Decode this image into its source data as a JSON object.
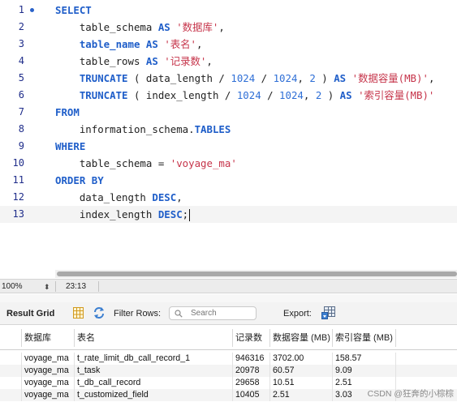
{
  "editor": {
    "lines": [
      {
        "no": "1",
        "tokens": [
          {
            "t": "SELECT",
            "c": "kw"
          }
        ]
      },
      {
        "no": "2",
        "tokens": [
          {
            "t": "    table_schema ",
            "c": "ob"
          },
          {
            "t": "AS",
            "c": "kw"
          },
          {
            "t": " ",
            "c": "ob"
          },
          {
            "t": "'数据库'",
            "c": "str"
          },
          {
            "t": ",",
            "c": "ob"
          }
        ]
      },
      {
        "no": "3",
        "tokens": [
          {
            "t": "    ",
            "c": "ob"
          },
          {
            "t": "table_name",
            "c": "id"
          },
          {
            "t": " ",
            "c": "ob"
          },
          {
            "t": "AS",
            "c": "kw"
          },
          {
            "t": " ",
            "c": "ob"
          },
          {
            "t": "'表名'",
            "c": "str"
          },
          {
            "t": ",",
            "c": "ob"
          }
        ]
      },
      {
        "no": "4",
        "tokens": [
          {
            "t": "    table_rows ",
            "c": "ob"
          },
          {
            "t": "AS",
            "c": "kw"
          },
          {
            "t": " ",
            "c": "ob"
          },
          {
            "t": "'记录数'",
            "c": "str"
          },
          {
            "t": ",",
            "c": "ob"
          }
        ]
      },
      {
        "no": "5",
        "tokens": [
          {
            "t": "    ",
            "c": "ob"
          },
          {
            "t": "TRUNCATE",
            "c": "fn"
          },
          {
            "t": " ( data_length / ",
            "c": "ob"
          },
          {
            "t": "1024",
            "c": "num"
          },
          {
            "t": " / ",
            "c": "ob"
          },
          {
            "t": "1024",
            "c": "num"
          },
          {
            "t": ", ",
            "c": "ob"
          },
          {
            "t": "2",
            "c": "num"
          },
          {
            "t": " ) ",
            "c": "ob"
          },
          {
            "t": "AS",
            "c": "kw"
          },
          {
            "t": " ",
            "c": "ob"
          },
          {
            "t": "'数据容量(MB)'",
            "c": "str"
          },
          {
            "t": ",",
            "c": "ob"
          }
        ]
      },
      {
        "no": "6",
        "tokens": [
          {
            "t": "    ",
            "c": "ob"
          },
          {
            "t": "TRUNCATE",
            "c": "fn"
          },
          {
            "t": " ( index_length / ",
            "c": "ob"
          },
          {
            "t": "1024",
            "c": "num"
          },
          {
            "t": " / ",
            "c": "ob"
          },
          {
            "t": "1024",
            "c": "num"
          },
          {
            "t": ", ",
            "c": "ob"
          },
          {
            "t": "2",
            "c": "num"
          },
          {
            "t": " ) ",
            "c": "ob"
          },
          {
            "t": "AS",
            "c": "kw"
          },
          {
            "t": " ",
            "c": "ob"
          },
          {
            "t": "'索引容量(MB)'",
            "c": "str"
          }
        ]
      },
      {
        "no": "7",
        "tokens": [
          {
            "t": "FROM",
            "c": "kw"
          }
        ]
      },
      {
        "no": "8",
        "tokens": [
          {
            "t": "    information_schema.",
            "c": "ob"
          },
          {
            "t": "TABLES",
            "c": "id"
          }
        ]
      },
      {
        "no": "9",
        "tokens": [
          {
            "t": "WHERE",
            "c": "kw"
          }
        ]
      },
      {
        "no": "10",
        "tokens": [
          {
            "t": "    table_schema = ",
            "c": "ob"
          },
          {
            "t": "'voyage_ma'",
            "c": "str"
          }
        ]
      },
      {
        "no": "11",
        "tokens": [
          {
            "t": "ORDER BY",
            "c": "kw"
          }
        ]
      },
      {
        "no": "12",
        "tokens": [
          {
            "t": "    data_length ",
            "c": "ob"
          },
          {
            "t": "DESC",
            "c": "kw"
          },
          {
            "t": ",",
            "c": "ob"
          }
        ]
      },
      {
        "no": "13",
        "tokens": [
          {
            "t": "    index_length ",
            "c": "ob"
          },
          {
            "t": "DESC",
            "c": "kw"
          },
          {
            "t": ";",
            "c": "ob"
          }
        ]
      }
    ]
  },
  "statusbar": {
    "zoom": "100%",
    "cursor": "23:13"
  },
  "toolbar": {
    "result_grid_label": "Result Grid",
    "filter_label": "Filter Rows:",
    "search_placeholder": "Search",
    "export_label": "Export:"
  },
  "grid": {
    "columns": [
      "数据库",
      "表名",
      "记录数",
      "数据容量 (MB)",
      "索引容量 (MB)"
    ],
    "rows": [
      [
        "voyage_ma",
        "t_rate_limit_db_call_record_1",
        "946316",
        "3702.00",
        "158.57"
      ],
      [
        "voyage_ma",
        "t_task",
        "20978",
        "60.57",
        "9.09"
      ],
      [
        "voyage_ma",
        "t_db_call_record",
        "29658",
        "10.51",
        "2.51"
      ],
      [
        "voyage_ma",
        "t_customized_field",
        "10405",
        "2.51",
        "3.03"
      ]
    ]
  },
  "watermark": "CSDN @狂奔的小棕棕",
  "icons": {
    "breakpoint": "breakpoint-dot-icon",
    "grid": "grid-icon",
    "refresh": "refresh-icon",
    "search": "search-icon",
    "export": "export-icon"
  },
  "colors": {
    "keyword": "#1f5ec9",
    "string": "#c6344a",
    "number": "#2f6fd6",
    "line_number": "#1f2d8a"
  }
}
